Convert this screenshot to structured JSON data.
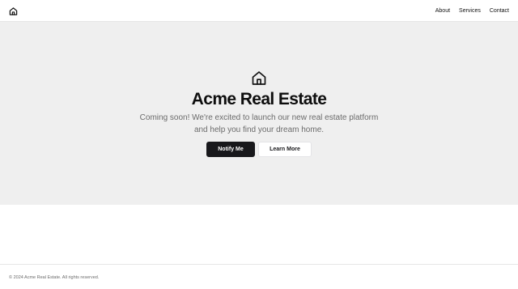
{
  "header": {
    "logo_icon": "home-icon",
    "nav": [
      {
        "label": "About"
      },
      {
        "label": "Services"
      },
      {
        "label": "Contact"
      }
    ]
  },
  "hero": {
    "icon": "home-icon",
    "title": "Acme Real Estate",
    "subtitle": "Coming soon! We're excited to launch our new real estate platform and help you find your dream home.",
    "primary_button": "Notify Me",
    "secondary_button": "Learn More"
  },
  "footer": {
    "text": "© 2024 Acme Real Estate. All rights reserved."
  },
  "colors": {
    "hero_background": "#efefef",
    "primary_button": "#18181b",
    "text_muted": "#6b6b6b"
  }
}
